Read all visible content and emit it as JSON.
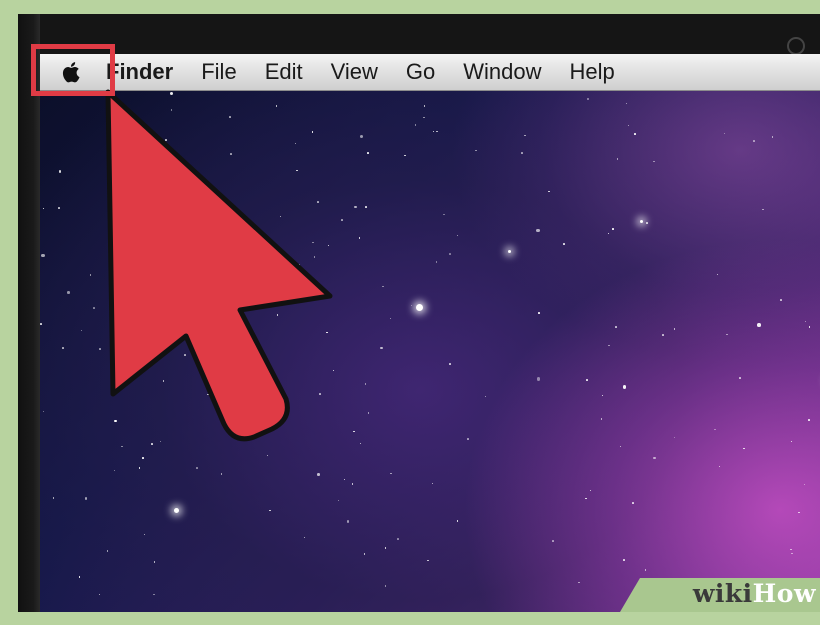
{
  "menubar": {
    "apple_icon": "apple-logo-icon",
    "items": [
      {
        "label": "Finder",
        "bold": true
      },
      {
        "label": "File"
      },
      {
        "label": "Edit"
      },
      {
        "label": "View"
      },
      {
        "label": "Go"
      },
      {
        "label": "Window"
      },
      {
        "label": "Help"
      }
    ]
  },
  "annotation": {
    "arrow_color": "#e03b45",
    "arrow_icon": "pointer-arrow-icon",
    "highlight_color": "#e03b45"
  },
  "watermark": {
    "part1": "wiki",
    "part2": "How"
  },
  "colors": {
    "frame": "#b8d39f",
    "menubar": "#e2e2e2",
    "desktop_dark": "#0c0f2a",
    "desktop_purple": "#8a3c9a"
  }
}
